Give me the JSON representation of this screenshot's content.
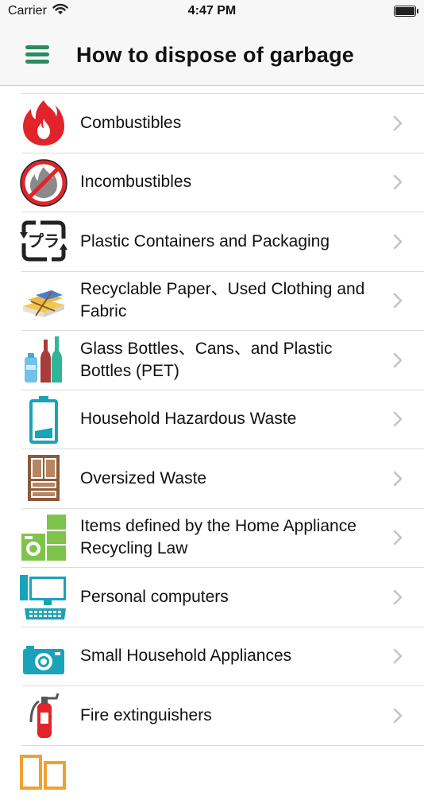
{
  "status_bar": {
    "carrier": "Carrier",
    "time": "4:47 PM"
  },
  "navbar": {
    "title": "How to dispose of garbage",
    "menu_icon": "hamburger-menu-icon"
  },
  "colors": {
    "accent": "#2b8a5f",
    "teal": "#1aa3b8",
    "red": "#e0242a"
  },
  "items": [
    {
      "label": "Combustibles",
      "icon": "flame-icon"
    },
    {
      "label": "Incombustibles",
      "icon": "no-fire-icon"
    },
    {
      "label": "Plastic Containers and Packaging",
      "icon": "plastic-recycle-icon"
    },
    {
      "label": "Recyclable Paper、Used Clothing and Fabric",
      "icon": "paper-bundle-icon"
    },
    {
      "label": "Glass Bottles、Cans、and Plastic Bottles (PET)",
      "icon": "bottles-icon"
    },
    {
      "label": "Household Hazardous Waste",
      "icon": "battery-icon"
    },
    {
      "label": "Oversized Waste",
      "icon": "cabinet-icon"
    },
    {
      "label": "Items defined by the Home Appliance Recycling Law",
      "icon": "home-appliance-icon"
    },
    {
      "label": "Personal computers",
      "icon": "computer-icon"
    },
    {
      "label": "Small Household Appliances",
      "icon": "camera-icon"
    },
    {
      "label": "Fire extinguishers",
      "icon": "fire-extinguisher-icon"
    }
  ]
}
